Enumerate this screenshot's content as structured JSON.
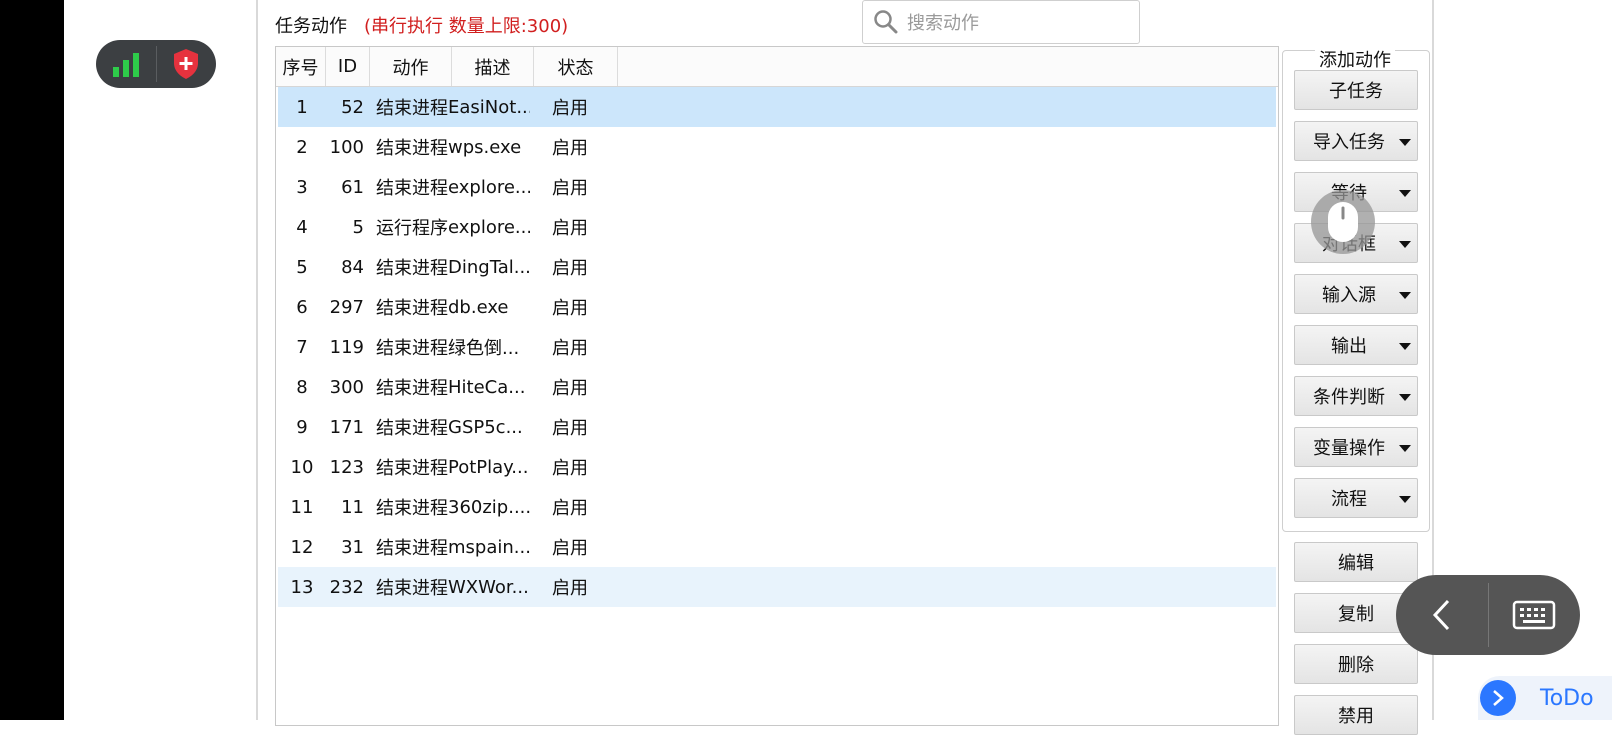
{
  "header": {
    "title": "任务动作",
    "subtitle": "(串行执行 数量上限:300)",
    "search_placeholder": "搜索动作"
  },
  "table": {
    "columns": [
      "序号",
      "ID",
      "动作",
      "描述",
      "状态"
    ],
    "rows": [
      {
        "seq": "1",
        "id": "52",
        "action": "结束进程",
        "desc": "EasiNot...",
        "status": "启用"
      },
      {
        "seq": "2",
        "id": "100",
        "action": "结束进程",
        "desc": "wps.exe",
        "status": "启用"
      },
      {
        "seq": "3",
        "id": "61",
        "action": "结束进程",
        "desc": "explore...",
        "status": "启用"
      },
      {
        "seq": "4",
        "id": "5",
        "action": "运行程序",
        "desc": "explore...",
        "status": "启用"
      },
      {
        "seq": "5",
        "id": "84",
        "action": "结束进程",
        "desc": "DingTal...",
        "status": "启用"
      },
      {
        "seq": "6",
        "id": "297",
        "action": "结束进程",
        "desc": "db.exe",
        "status": "启用"
      },
      {
        "seq": "7",
        "id": "119",
        "action": "结束进程",
        "desc": "绿色倒...",
        "status": "启用"
      },
      {
        "seq": "8",
        "id": "300",
        "action": "结束进程",
        "desc": "HiteCa...",
        "status": "启用"
      },
      {
        "seq": "9",
        "id": "171",
        "action": "结束进程",
        "desc": "GSP5c...",
        "status": "启用"
      },
      {
        "seq": "10",
        "id": "123",
        "action": "结束进程",
        "desc": "PotPlay...",
        "status": "启用"
      },
      {
        "seq": "11",
        "id": "11",
        "action": "结束进程",
        "desc": "360zip....",
        "status": "启用"
      },
      {
        "seq": "12",
        "id": "31",
        "action": "结束进程",
        "desc": "mspain...",
        "status": "启用"
      },
      {
        "seq": "13",
        "id": "232",
        "action": "结束进程",
        "desc": "WXWor...",
        "status": "启用"
      }
    ]
  },
  "actions": {
    "group_title": "添加动作",
    "subtask": "子任务",
    "import_task": "导入任务",
    "wait": "等待",
    "dialog": "对话框",
    "input_source": "输入源",
    "output": "输出",
    "condition": "条件判断",
    "variable": "变量操作",
    "flow": "流程",
    "edit": "编辑",
    "copy": "复制",
    "delete": "删除",
    "disable": "禁用"
  },
  "todo_label": "ToDo",
  "colors": {
    "subtitle_red": "#d11f1f",
    "selected_row": "#cce6fb",
    "shield_red": "#e6323e",
    "signal_green": "#2ecc4a",
    "todo_blue": "#2b77ff"
  }
}
